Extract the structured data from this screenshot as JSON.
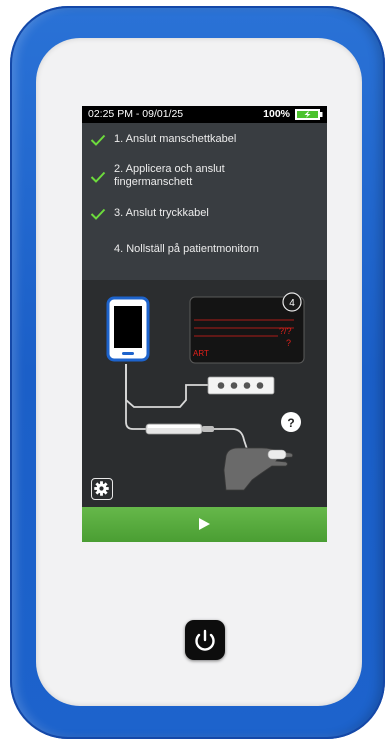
{
  "status": {
    "datetime": "02:25 PM - 09/01/25",
    "battery_percent": "100%"
  },
  "steps": [
    {
      "label": "1. Anslut manschettkabel",
      "done": true
    },
    {
      "label": "2. Applicera och anslut fingermanschett",
      "done": true
    },
    {
      "label": "3. Anslut tryckkabel",
      "done": true
    },
    {
      "label": "4. Nollställ på patientmonitorn",
      "done": false
    }
  ],
  "diagram": {
    "monitor_badge": "4",
    "monitor_value_1": "?/?",
    "monitor_value_2": "?",
    "monitor_channel": "ART",
    "hand_help": "?"
  },
  "colors": {
    "accent_green": "#4ba834",
    "check_green": "#6ddc3c",
    "device_blue": "#1d63cc",
    "alert_red": "#e0201b"
  },
  "icons": {
    "settings": "gear-icon",
    "start": "play-icon",
    "power": "power-icon"
  }
}
